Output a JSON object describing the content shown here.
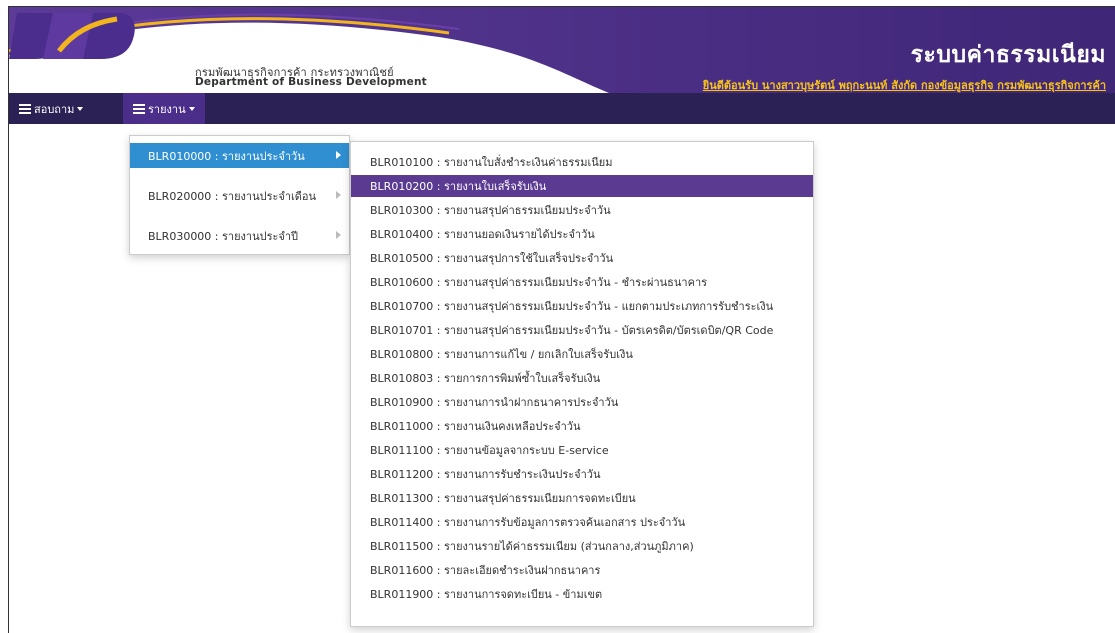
{
  "header": {
    "logo_text": "DBD",
    "org_th": "กรมพัฒนาธุรกิจการค้า กระทรวงพาณิชย์",
    "org_en": "Department of Business Development",
    "system_title": "ระบบค่าธรรมเนียม",
    "welcome": "ยินดีต้อนรับ นางสาวบุษรัตน์ พฤกะนนท์ สังกัด กองข้อมูลธุรกิจ กรมพัฒนาธุรกิจการค้า"
  },
  "nav": {
    "items": [
      {
        "label": "สอบถาม",
        "icon": "list-icon"
      },
      {
        "label": "รายงาน",
        "icon": "list-icon"
      }
    ]
  },
  "menu_level1": {
    "items": [
      {
        "label": "BLR010000 : รายงานประจำวัน",
        "active": true
      },
      {
        "label": "BLR020000 : รายงานประจำเดือน",
        "active": false
      },
      {
        "label": "BLR030000 : รายงานประจำปี",
        "active": false
      }
    ]
  },
  "menu_level2": {
    "items": [
      {
        "label": "BLR010100 : รายงานใบสั่งชำระเงินค่าธรรมเนียม"
      },
      {
        "label": "BLR010200 : รายงานใบเสร็จรับเงิน",
        "active": true
      },
      {
        "label": "BLR010300 : รายงานสรุปค่าธรรมเนียมประจำวัน"
      },
      {
        "label": "BLR010400 : รายงานยอดเงินรายได้ประจำวัน"
      },
      {
        "label": "BLR010500 : รายงานสรุปการใช้ใบเสร็จประจำวัน"
      },
      {
        "label": "BLR010600 : รายงานสรุปค่าธรรมเนียมประจำวัน - ชำระผ่านธนาคาร"
      },
      {
        "label": "BLR010700 : รายงานสรุปค่าธรรมเนียมประจำวัน - แยกตามประเภทการรับชำระเงิน"
      },
      {
        "label": "BLR010701 : รายงานสรุปค่าธรรมเนียมประจำวัน - บัตรเครดิต/บัตรเดบิต/QR Code"
      },
      {
        "label": "BLR010800 : รายงานการแก้ไข / ยกเลิกใบเสร็จรับเงิน"
      },
      {
        "label": "BLR010803 : รายการการพิมพ์ซ้ำใบเสร็จรับเงิน"
      },
      {
        "label": "BLR010900 : รายงานการนำฝากธนาคารประจำวัน"
      },
      {
        "label": "BLR011000 : รายงานเงินคงเหลือประจำวัน"
      },
      {
        "label": "BLR011100 : รายงานข้อมูลจากระบบ E-service"
      },
      {
        "label": "BLR011200 : รายงานการรับชำระเงินประจำวัน"
      },
      {
        "label": "BLR011300 : รายงานสรุปค่าธรรมเนียมการจดทะเบียน"
      },
      {
        "label": "BLR011400 : รายงานการรับข้อมูลการตรวจค้นเอกสาร ประจำวัน"
      },
      {
        "label": "BLR011500 : รายงานรายได้ค่าธรรมเนียม (ส่วนกลาง,ส่วนภูมิภาค)"
      },
      {
        "label": "BLR011600 : รายละเอียดชำระเงินฝากธนาคาร"
      },
      {
        "label": "BLR011900 : รายงานการจดทะเบียน - ข้ามเขต"
      }
    ]
  },
  "colors": {
    "banner_purple": "#4a2d86",
    "navbar": "#2b2154",
    "active_blue": "#2f8fd1",
    "active_purple": "#5b3a92",
    "welcome_gold": "#f7c21a"
  }
}
